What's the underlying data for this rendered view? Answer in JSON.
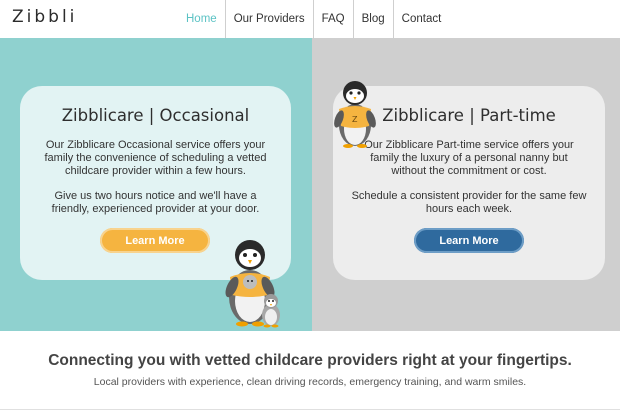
{
  "header": {
    "logo": "Zibbli",
    "nav": [
      {
        "label": "Home",
        "active": true
      },
      {
        "label": "Our Providers",
        "active": false
      },
      {
        "label": "FAQ",
        "active": false
      },
      {
        "label": "Blog",
        "active": false
      },
      {
        "label": "Contact",
        "active": false
      }
    ]
  },
  "occasional": {
    "title": "Zibblicare | Occasional",
    "text1": "Our Zibblicare Occasional service offers your family the convenience of scheduling a vetted childcare provider within a few hours.",
    "text2": "Give us two hours notice and we'll have a friendly, experienced provider at your door.",
    "button": "Learn More",
    "button_color": "#f5b440",
    "panel_color": "#8fd1cf"
  },
  "parttime": {
    "title": "Zibblicare | Part-time",
    "text1": "Our Zibblicare Part-time service offers your family the luxury of a personal nanny but without the commitment or cost.",
    "text2": "Schedule a consistent provider for the same few hours each week.",
    "button": "Learn More",
    "button_color": "#2f6a9e",
    "panel_color": "#cfcfcf"
  },
  "mascot": {
    "shirt_letter": "Z",
    "shirt_color": "#f5b440",
    "icon": "penguin-mascot"
  },
  "bottom": {
    "tagline": "Connecting you with vetted childcare providers right at your fingertips.",
    "subline": "Local providers with experience, clean driving records, emergency training, and warm smiles."
  }
}
